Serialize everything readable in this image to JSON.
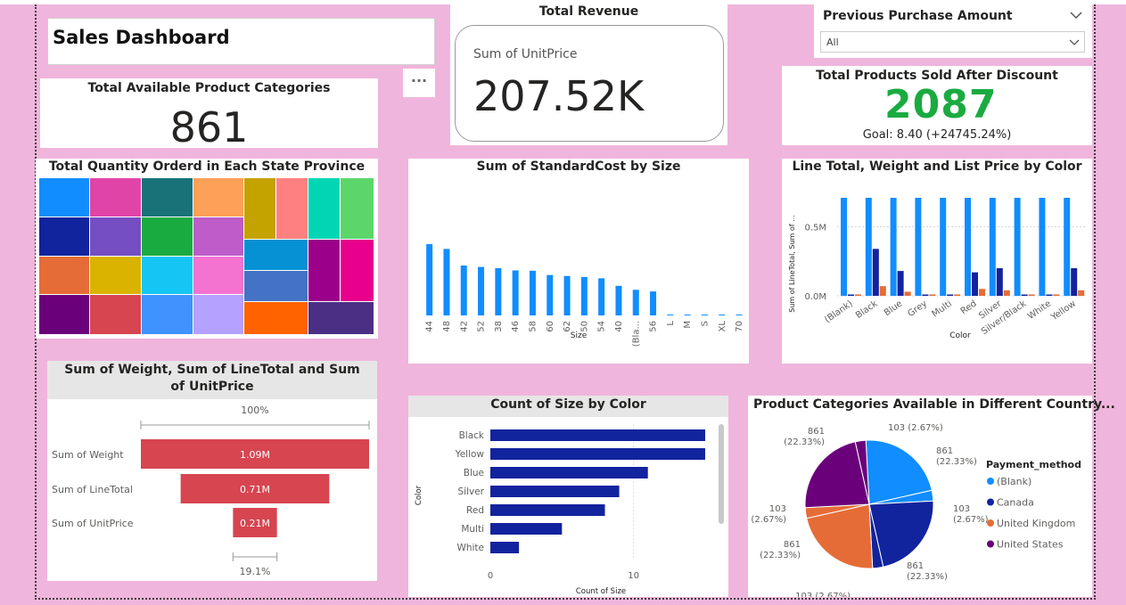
{
  "page_title": "Sales Dashboard",
  "more_options": "···",
  "kpi_categories": {
    "title": "Total Available Product Categories",
    "value": "861"
  },
  "kpi_revenue": {
    "title": "Total Revenue",
    "label": "Sum of UnitPrice",
    "value": "207.52K"
  },
  "slicer": {
    "title": "Previous Purchase Amount",
    "selected": "All"
  },
  "kpi_discount": {
    "title": "Total Products Sold After Discount",
    "value": "2087",
    "goal": "Goal: 8.40 (+24745.24%)",
    "color": "#1aab40"
  },
  "colors": {
    "accent": "#118dff",
    "dark_blue": "#12239e",
    "orange": "#e66c37",
    "purple": "#6b007b",
    "red": "#d64550"
  },
  "treemap": {
    "title": "Total Quantity Orderd in Each State Province",
    "colors": [
      "#118dff",
      "#12239e",
      "#e66c37",
      "#6b007b",
      "#e044a7",
      "#744ec2",
      "#d9b300",
      "#d64550",
      "#197278",
      "#1aab40",
      "#15c6f4",
      "#4092ff",
      "#ffa058",
      "#be5dc9",
      "#f472d0",
      "#b5a1ff",
      "#c4a200",
      "#0591d4",
      "#4472c4",
      "#ff6300",
      "#ff8080",
      "#9a0089",
      "#00d6b4",
      "#5cd66b",
      "#e8008c",
      "#4b2f84"
    ]
  },
  "chart_data": [
    {
      "type": "bar",
      "title": "Sum of StandardCost by Size",
      "xlabel": "Size",
      "ylabel": "",
      "categories": [
        "44",
        "48",
        "42",
        "52",
        "38",
        "46",
        "58",
        "60",
        "62",
        "50",
        "54",
        "40",
        "(Bla...",
        "56",
        "L",
        "M",
        "S",
        "XL",
        "70"
      ],
      "values": [
        1085,
        1012,
        760,
        738,
        720,
        685,
        680,
        615,
        600,
        585,
        565,
        450,
        390,
        365,
        12,
        12,
        10,
        10,
        8
      ],
      "ylim": [
        0,
        1400
      ]
    },
    {
      "type": "bar",
      "title": "Line Total, Weight and List Price by Color",
      "xlabel": "Color",
      "ylabel": "Sum of LineTotal, Sum of ...",
      "categories": [
        "(Blank)",
        "Black",
        "Blue",
        "Grey",
        "Multi",
        "Red",
        "Silver",
        "Silver/Black",
        "White",
        "Yellow"
      ],
      "ytick_labels": [
        "0.0M",
        "0.5M"
      ],
      "series": [
        {
          "values": [
            0.71,
            0.71,
            0.71,
            0.71,
            0.71,
            0.71,
            0.71,
            0.71,
            0.71,
            0.71
          ]
        },
        {
          "values": [
            0.0,
            0.34,
            0.18,
            0.0,
            0.0,
            0.17,
            0.2,
            0.0,
            0.0,
            0.2
          ]
        },
        {
          "values": [
            0.01,
            0.07,
            0.03,
            0.01,
            0.01,
            0.05,
            0.04,
            0.01,
            0.01,
            0.04
          ]
        }
      ],
      "ylim": [
        0,
        0.8
      ]
    },
    {
      "type": "bar",
      "title": "Sum of Weight, Sum of LineTotal and Sum of UnitPrice",
      "categories": [
        "Sum of Weight",
        "Sum of LineTotal",
        "Sum of UnitPrice"
      ],
      "values": [
        1.09,
        0.71,
        0.21
      ],
      "value_labels": [
        "1.09M",
        "0.71M",
        "0.21M"
      ],
      "top_label": "100%",
      "bottom_label": "19.1%"
    },
    {
      "type": "bar",
      "title": "Count of Size by Color",
      "xlabel": "Count of Size",
      "ylabel": "Color",
      "categories": [
        "Black",
        "Yellow",
        "Blue",
        "Silver",
        "Red",
        "Multi",
        "White"
      ],
      "values": [
        15,
        15,
        11,
        9,
        8,
        5,
        2
      ],
      "xticks": [
        "0",
        "10"
      ],
      "xlim": [
        0,
        15.5
      ]
    },
    {
      "type": "pie",
      "title": "Product Categories Available in Different Country...",
      "legend_title": "Payment_method",
      "legend_position": "right",
      "labels": [
        "(Blank)",
        "Canada",
        "United Kingdom",
        "United States"
      ],
      "slice_labels": [
        [
          "861",
          "(22.33%)"
        ],
        [
          "103 (2.67%)"
        ],
        [
          "861",
          "(22.33%)"
        ],
        [
          "103",
          "(2.67%)"
        ],
        [
          "861",
          "(22.33%)"
        ],
        [
          "103 (2.67%)"
        ],
        [
          "861",
          "(22.33%)"
        ],
        [
          "103",
          "(2.67%)"
        ]
      ],
      "values": [
        861,
        103,
        861,
        103,
        861,
        103,
        861,
        103
      ]
    }
  ]
}
